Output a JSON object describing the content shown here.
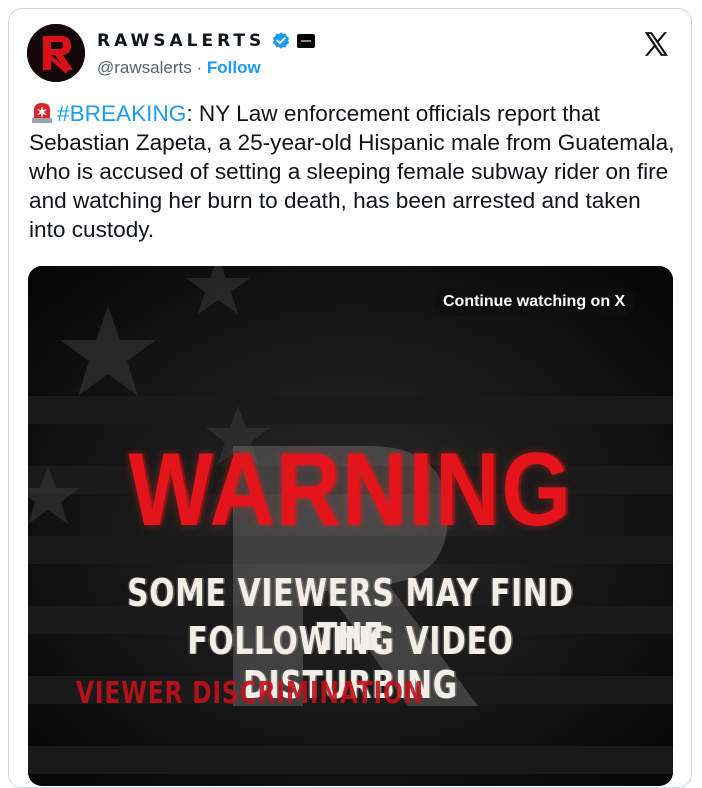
{
  "author": {
    "display_name": "RAWSALERTS",
    "handle": "@rawsalerts",
    "separator": "·",
    "follow_label": "Follow",
    "verified_icon": "verified-badge-icon",
    "avatar_icon": "raws-logo-avatar"
  },
  "platform": {
    "logo": "x-logo-icon"
  },
  "tweet": {
    "emoji": "siren-icon",
    "hashtag": "#BREAKING",
    "text": ": NY Law enforcement officials report that Sebastian Zapeta, a 25-year-old Hispanic male from Guatemala, who is accused of setting a sleeping female subway rider on fire and watching her burn to death, has been arrested and taken into custody."
  },
  "video": {
    "continue_label": "Continue watching on X",
    "warning_title": "WARNING",
    "warning_line1": "SOME VIEWERS MAY FIND THE",
    "warning_line2": "FOLLOWING VIDEO DISTURBING",
    "warning_sub": "VIEWER DISCRIMINATION"
  },
  "colors": {
    "link": "#1d9bf0",
    "text": "#0f1419",
    "secondary": "#536471",
    "warning_red": "#e3151a"
  }
}
